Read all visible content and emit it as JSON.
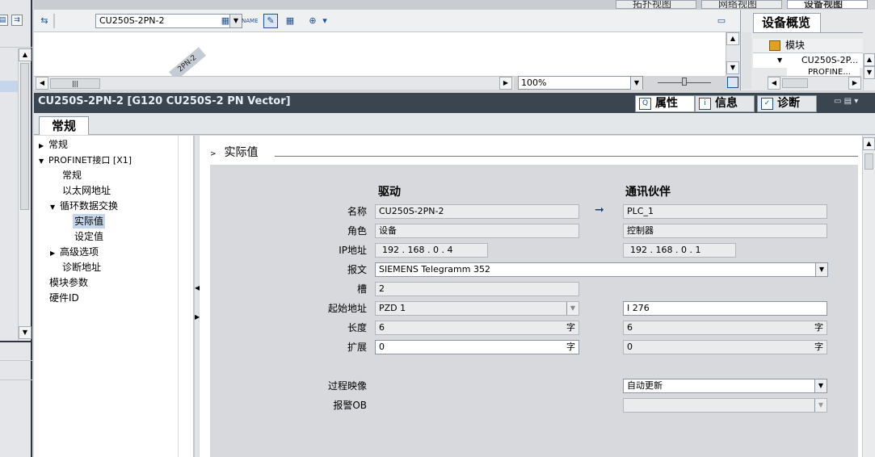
{
  "top": {
    "view_tabs": [
      "拓扑视图",
      "网络视图",
      "设备视图"
    ],
    "device_select": "CU250S-2PN-2",
    "canvas_device_label": "2PN-2",
    "zoom": "100%"
  },
  "overview": {
    "title": "设备概览",
    "column_module": "模块",
    "row1": "CU250S-2P...",
    "row2": "PROFINE..."
  },
  "inspector": {
    "title": "CU250S-2PN-2 [G120 CU250S-2 PN Vector]",
    "tabs": [
      "属性",
      "信息",
      "诊断"
    ],
    "subtab": "常规"
  },
  "nav": {
    "items": [
      "常规",
      "PROFINET接口 [X1]",
      "常规",
      "以太网地址",
      "循环数据交换",
      "实际值",
      "设定值",
      "高级选项",
      "诊断地址",
      "模块参数",
      "硬件ID"
    ]
  },
  "section": {
    "title": "实际值"
  },
  "form": {
    "col_drive": "驱动",
    "col_partner": "通讯伙伴",
    "labels": {
      "name": "名称",
      "role": "角色",
      "ip": "IP地址",
      "telegram": "报文",
      "slot": "槽",
      "start_addr": "起始地址",
      "length": "长度",
      "extension": "扩展",
      "process_image": "过程映像",
      "alarm_ob": "报警OB"
    },
    "drive": {
      "name": "CU250S-2PN-2",
      "role": "设备",
      "ip": "192 . 168 . 0   . 4",
      "telegram": "SIEMENS Telegramm 352",
      "slot": "2",
      "start_addr": "PZD 1",
      "length": "6",
      "length_unit": "字",
      "extension": "0",
      "extension_unit": "字"
    },
    "partner": {
      "name": "PLC_1",
      "role": "控制器",
      "ip": "192 . 168 . 0   . 1",
      "start_addr": "I 276",
      "length": "6",
      "length_unit": "字",
      "extension": "0",
      "extension_unit": "字",
      "process_image": "自动更新",
      "alarm_ob": ""
    }
  }
}
